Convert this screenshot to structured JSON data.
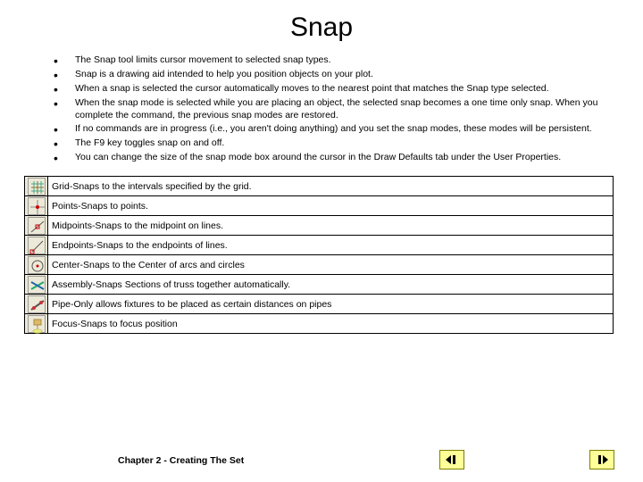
{
  "title": "Snap",
  "bullets": [
    "The Snap tool limits cursor movement to selected snap types.",
    "Snap is a drawing aid intended to help you position objects on your plot.",
    "When a snap is selected the cursor automatically moves to the nearest point that matches the Snap type selected.",
    "When the snap mode is selected while you are placing an object, the selected snap becomes a one time only snap.  When you complete the command, the previous snap modes are restored.",
    "If no commands are in progress (i.e., you aren't doing anything) and you set the snap modes, these modes will be persistent.",
    "The F9 key toggles snap on and off.",
    "You can change the size of the snap mode box around the cursor in the Draw Defaults tab under the User Properties."
  ],
  "snap_modes": [
    {
      "icon": "grid-icon",
      "text": "Grid-Snaps to the intervals specified by the grid."
    },
    {
      "icon": "points-icon",
      "text": "Points-Snaps to points."
    },
    {
      "icon": "midpoint-icon",
      "text": "Midpoints-Snaps to the midpoint on lines."
    },
    {
      "icon": "endpoint-icon",
      "text": "Endpoints-Snaps to the endpoints of lines."
    },
    {
      "icon": "center-icon",
      "text": "Center-Snaps to the Center of arcs and circles"
    },
    {
      "icon": "assembly-icon",
      "text": "Assembly-Snaps Sections of truss together automatically."
    },
    {
      "icon": "pipe-icon",
      "text": "Pipe-Only allows fixtures to be placed as certain distances on pipes"
    },
    {
      "icon": "focus-icon",
      "text": "Focus-Snaps to focus position"
    }
  ],
  "footer": "Chapter 2 - Creating The Set",
  "nav": {
    "prev": "prev",
    "next": "next"
  }
}
